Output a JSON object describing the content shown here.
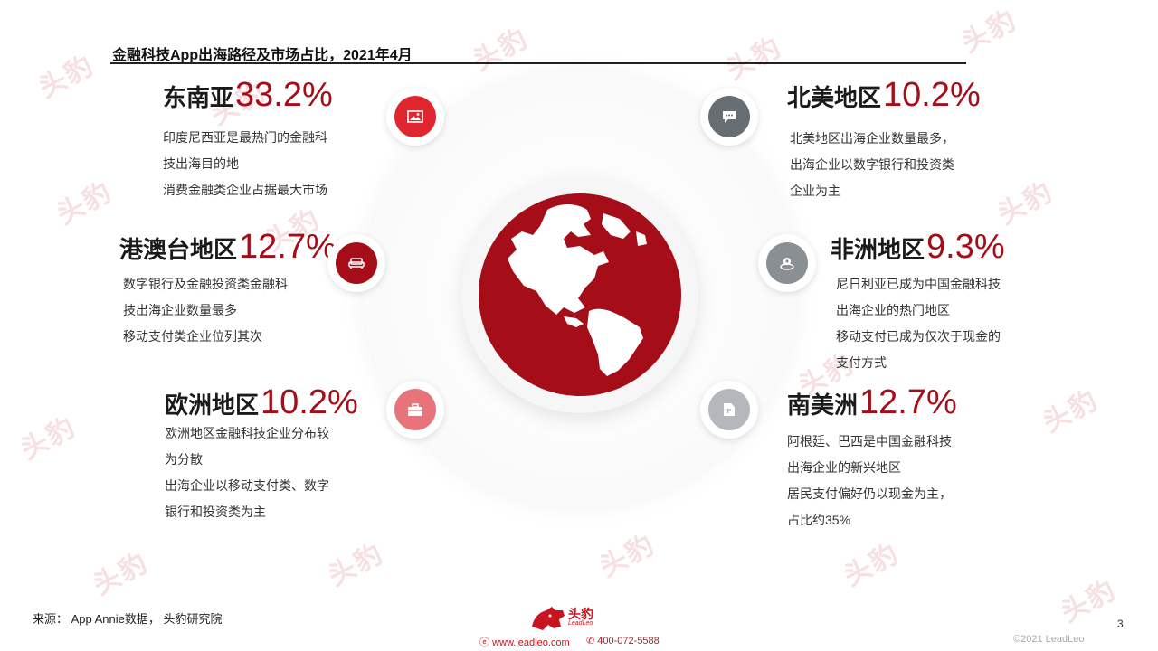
{
  "title": "金融科技App出海路径及市场占比，2021年4月",
  "watermark_text": "头豹",
  "regions": [
    {
      "name": "东南亚",
      "pct": "33.2%",
      "lines": [
        "印度尼西亚是最热门的金融科",
        "技出海目的地",
        "消费金融类企业占据最大市场"
      ],
      "icon": "image-icon",
      "color": "#e0262f"
    },
    {
      "name": "港澳台地区",
      "pct": "12.7%",
      "lines": [
        "数字银行及金融投资类金融科",
        "技出海企业数量最多",
        "移动支付类企业位列其次"
      ],
      "icon": "sofa-icon",
      "color": "#a50d18"
    },
    {
      "name": "欧洲地区",
      "pct": "10.2%",
      "lines": [
        "欧洲地区金融科技企业分布较",
        "为分散",
        "出海企业以移动支付类、数字",
        "银行和投资类为主"
      ],
      "icon": "briefcase-icon",
      "color": "#e8747b"
    },
    {
      "name": "北美地区",
      "pct": "10.2%",
      "lines": [
        "北美地区出海企业数量最多，",
        "出海企业以数字银行和投资类",
        "企业为主"
      ],
      "icon": "chat-icon",
      "color": "#666d73"
    },
    {
      "name": "非洲地区",
      "pct": "9.3%",
      "lines": [
        "尼日利亚已成为中国金融科技",
        "出海企业的热门地区",
        "移动支付已成为仅次于现金的",
        "支付方式"
      ],
      "icon": "location-icon",
      "color": "#8a8f94"
    },
    {
      "name": "南美洲",
      "pct": "12.7%",
      "lines": [
        "阿根廷、巴西是中国金融科技",
        "出海企业的新兴地区",
        "居民支付偏好仍以现金为主，",
        "占比约35%"
      ],
      "icon": "parking-icon",
      "color": "#b4b8bc"
    }
  ],
  "footer": {
    "source": "来源：  App Annie数据，  头豹研究院",
    "logo_text": "头豹",
    "logo_sub": "LeadLeo",
    "website": "www.leadleo.com",
    "phone": "400-072-5588",
    "copyright": "©2021 LeadLeo",
    "page_number": "3"
  }
}
